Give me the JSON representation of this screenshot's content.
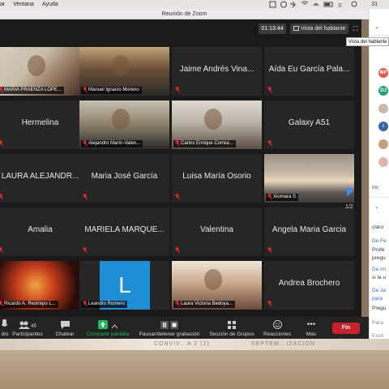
{
  "menubar": {
    "items": [
      "ar",
      "Ventana",
      "Ayuda"
    ],
    "clock": "31"
  },
  "window": {
    "title": "Reunión de Zoom"
  },
  "meeting": {
    "timer": "01:13:44",
    "view_button": "Vista del hablante",
    "tooltip": "Vista del hablante",
    "page": "1/2"
  },
  "tiles": [
    {
      "name": "MARIA PRAENZA LOPE...",
      "kind": "video"
    },
    {
      "name": "Manuel Ignacio Moreno",
      "kind": "video"
    },
    {
      "name": "Jaime Andrés Vina...",
      "kind": "text"
    },
    {
      "name": "Aída Eu García Pala...",
      "kind": "text"
    },
    {
      "name": "Hermelina",
      "kind": "text"
    },
    {
      "name": "Alejandro Marín-Valen...",
      "kind": "video"
    },
    {
      "name": "Carlos Enrique Correa...",
      "kind": "video"
    },
    {
      "name": "Galaxy A51",
      "kind": "text"
    },
    {
      "name": "LAURA ALEJANDR...",
      "kind": "text"
    },
    {
      "name": "Maria José García",
      "kind": "text"
    },
    {
      "name": "Luisa María Osorio",
      "kind": "text"
    },
    {
      "name": "Xiomara S",
      "kind": "video"
    },
    {
      "name": "Amalia",
      "kind": "text"
    },
    {
      "name": "MARIELA MARQUE...",
      "kind": "text"
    },
    {
      "name": "Valentina",
      "kind": "text"
    },
    {
      "name": "Angela Maria Garcia",
      "kind": "text"
    },
    {
      "name": "Ricardo A. Restrepo L...",
      "kind": "video"
    },
    {
      "name": "Leandro Romero",
      "kind": "avatar",
      "letter": "L"
    },
    {
      "name": "Laura Victoria Bedoya...",
      "kind": "video"
    },
    {
      "name": "Andrea Brochero",
      "kind": "text"
    }
  ],
  "toolbar": {
    "audio": "dio",
    "participants": "Participantes",
    "participants_count": "45",
    "chat": "Chatear",
    "share": "Compartir pantalla",
    "record": "Pausar/detener grabación",
    "breakout": "Sección de Grupos",
    "reactions": "Reacciones",
    "more": "Más",
    "end": "Fin"
  },
  "panel": {
    "avatars": [
      {
        "initials": "MP",
        "color": "#e35a4a"
      },
      {
        "initials": "DJ",
        "color": "#24a37a"
      },
      {
        "initials": "",
        "color": "#c9b8a8"
      },
      {
        "initials": "i",
        "color": "#3a63a8"
      },
      {
        "initials": "",
        "color": "#c8a07e"
      },
      {
        "initials": "",
        "color": "#d9b8b0"
      }
    ],
    "invite": "Inv",
    "chat_lines": [
      {
        "text": "claro",
        "style": "plain"
      },
      {
        "text": "De Fe",
        "style": "gray"
      },
      {
        "text": "Profe",
        "style": "plain"
      },
      {
        "text": "pregu",
        "style": "plain"
      },
      {
        "text": "De mi",
        "style": "gray"
      },
      {
        "text": "si la u",
        "style": "plain"
      },
      {
        "text": "De Ja",
        "style": "gray"
      },
      {
        "text": "para",
        "style": "gray"
      },
      {
        "text": "Pregu",
        "style": "plain"
      },
      {
        "text": "Para:",
        "style": "gray"
      },
      {
        "text": "Escri",
        "style": "gray"
      }
    ]
  },
  "desk_marks": [
    "CONVIV...A 2 (2)",
    "SEPTEM...IZACION"
  ]
}
